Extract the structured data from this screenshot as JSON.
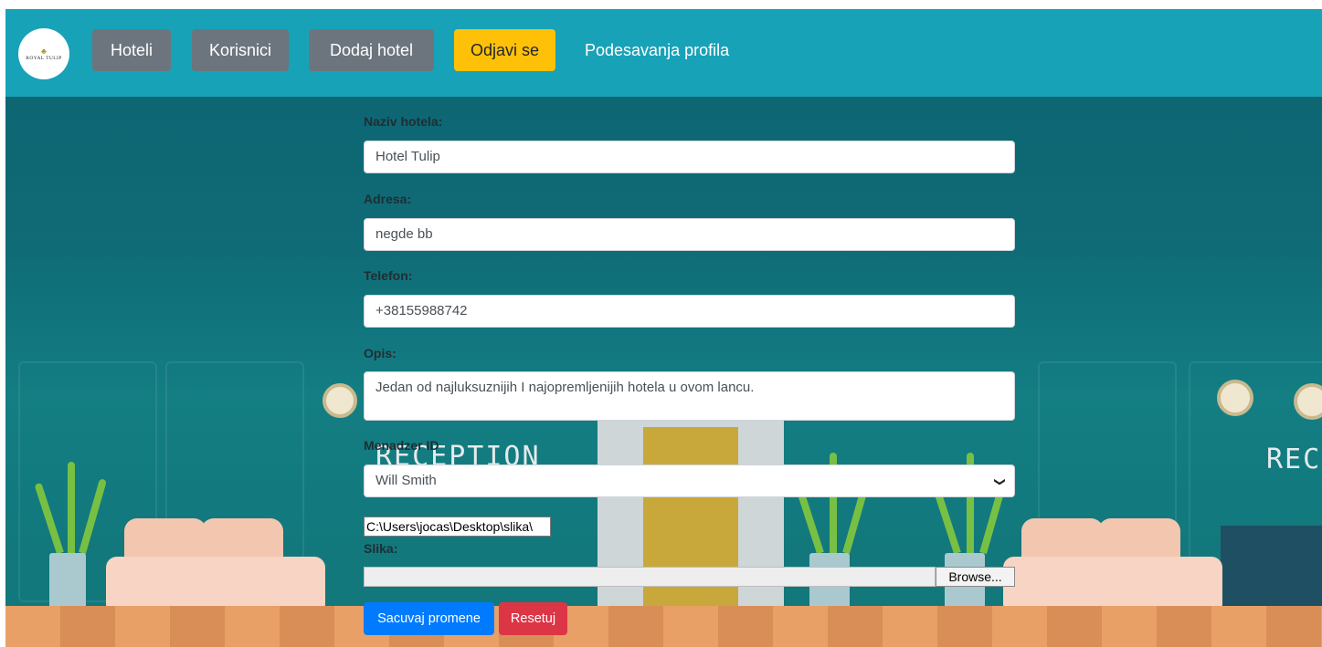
{
  "colors": {
    "navbar": "#17a2b8",
    "nav_gray": "#6c757d",
    "nav_yellow": "#ffc107",
    "primary": "#007bff",
    "danger": "#dc3545",
    "teal_bg": "#0f6b76"
  },
  "logo": {
    "brand": "ROYAL TULIP",
    "icon": "tulip-leaf-icon"
  },
  "nav": {
    "hoteli": "Hoteli",
    "korisnici": "Korisnici",
    "dodaj_hotel": "Dodaj hotel",
    "odjavi_se": "Odjavi se",
    "podesavanja": "Podesavanja profila"
  },
  "scene": {
    "reception_left": "RECEPTION",
    "reception_right": "RECEI"
  },
  "form": {
    "naziv_label": "Naziv hotela:",
    "naziv_value": "Hotel Tulip",
    "adresa_label": "Adresa:",
    "adresa_value": "negde bb",
    "telefon_label": "Telefon:",
    "telefon_value": "+38155988742",
    "opis_label": "Opis:",
    "opis_value": "Jedan od najluksuznijih I najopremljenijih hotela u ovom lancu.",
    "menadzer_label": "Menadzer ID",
    "menadzer_value": "Will Smith",
    "file_path": "C:\\Users\\jocas\\Desktop\\slika\\",
    "slika_label": "Slika:",
    "browse_label": "Browse...",
    "save_label": "Sacuvaj promene",
    "reset_label": "Resetuj"
  }
}
